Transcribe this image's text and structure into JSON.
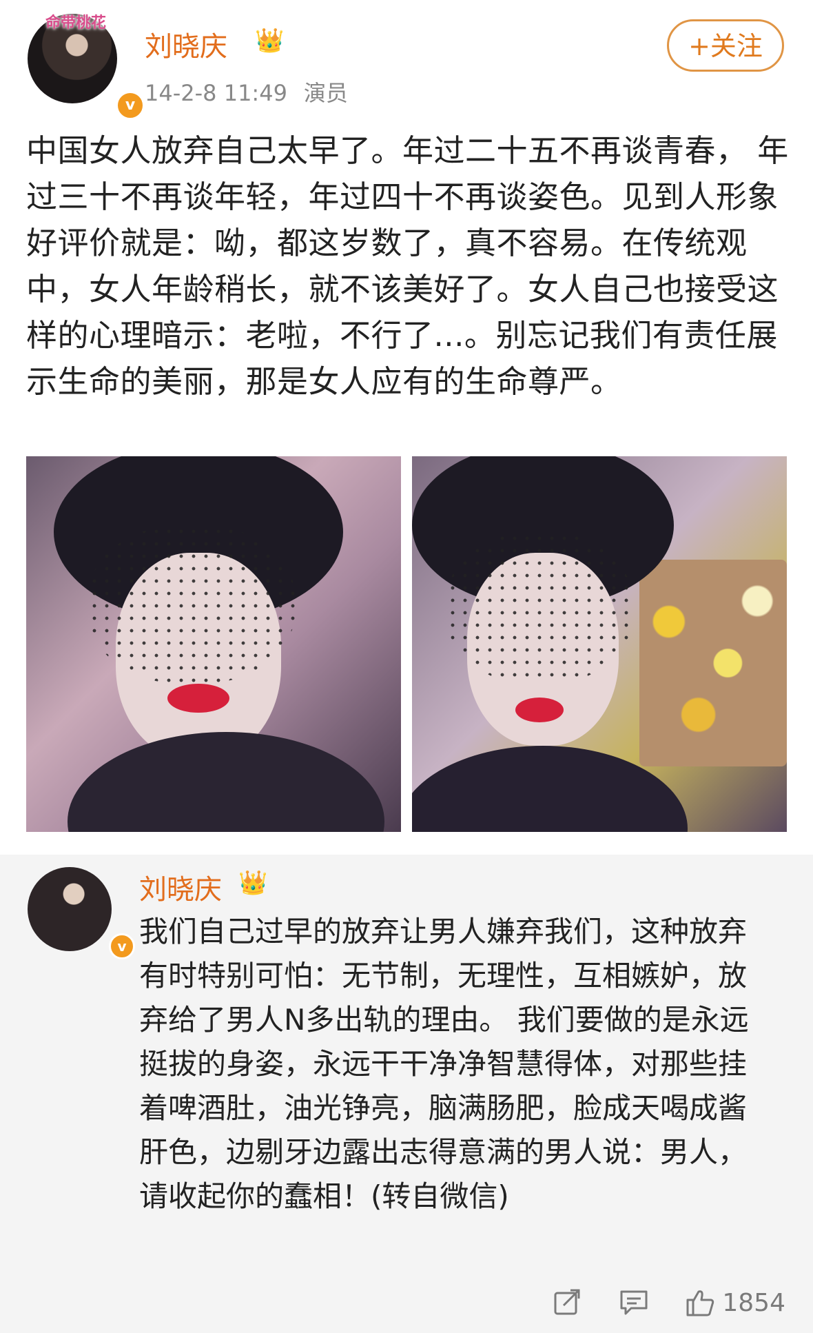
{
  "post": {
    "author": "刘晓庆",
    "time": "14-2-8 11:49",
    "source": "演员",
    "avatar_badge": "命带桃花",
    "follow_label": "+关注",
    "verified_mark": "v",
    "text": "中国女人放弃自己太早了。年过二十五不再谈青春， 年过三十不再谈年轻，年过四十不再谈姿色。见到人形象好评价就是：呦，都这岁数了，真不容易。在传统观中，女人年龄稍长，就不该美好了。女人自己也接受这样的心理暗示：老啦，不行了...。别忘记我们有责任展示生命的美丽，那是女人应有的生命尊严。"
  },
  "repost": {
    "author": "刘晓庆",
    "verified_mark": "v",
    "text": "我们自己过早的放弃让男人嫌弃我们，这种放弃有时特别可怕：无节制，无理性，互相嫉妒，放弃给了男人N多出轨的理由。 我们要做的是永远挺拔的身姿，永远干干净净智慧得体，对那些挂着啤酒肚，油光铮亮，脑满肠肥，脸成天喝成酱肝色，边剔牙边露出志得意满的男人说：男人，请收起你的蠢相！(转自微信)"
  },
  "actions": {
    "share_icon": "share-icon",
    "comment_icon": "comment-icon",
    "like_icon": "like-icon",
    "like_count": "1854"
  },
  "colors": {
    "name": "#e26d1c",
    "follow_border": "#e09545",
    "verified": "#f39a1e",
    "repost_bg": "#f4f4f4"
  }
}
